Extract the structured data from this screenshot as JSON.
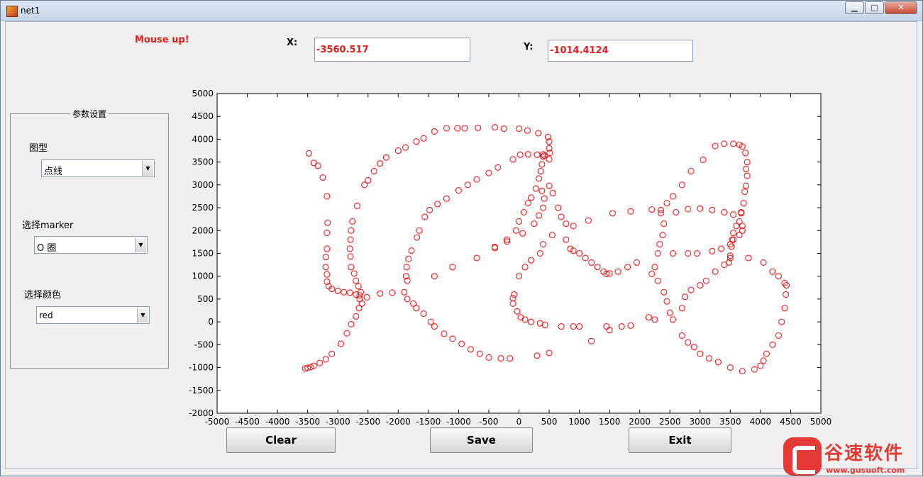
{
  "window": {
    "title": "net1",
    "minimize_glyph": "▁",
    "maximize_glyph": "□",
    "close_glyph": "✕"
  },
  "status": "Mouse up!",
  "coords": {
    "x_label": "X:",
    "x_value": "-3560.517",
    "y_label": "Y:",
    "y_value": "-1014.4124"
  },
  "panel": {
    "title": "参数设置",
    "chart_type": {
      "label": "图型",
      "selected": "点线"
    },
    "marker": {
      "label": "选择marker",
      "selected": "O 圈"
    },
    "color": {
      "label": "选择颜色",
      "selected": "red"
    }
  },
  "buttons": {
    "clear": "Clear",
    "save": "Save",
    "exit": "Exit"
  },
  "watermark": {
    "name": "谷速软件",
    "url": "www.gusuoft.com"
  },
  "colors": {
    "marker": "#ff0000",
    "status_text": "#e41c1c",
    "watermark": "#e53935"
  },
  "icons": {
    "app": "matlab-figure-icon",
    "dropdown": "chevron-down-icon"
  },
  "chart_data": {
    "type": "scatter",
    "marker": "circle",
    "title": "",
    "xlabel": "",
    "ylabel": "",
    "xlim": [
      -5000,
      5000
    ],
    "ylim": [
      -2000,
      5000
    ],
    "xticks": [
      -5000,
      -4500,
      -4000,
      -3500,
      -3000,
      -2500,
      -2000,
      -1500,
      -1000,
      -500,
      0,
      500,
      1000,
      1500,
      2000,
      2500,
      3000,
      3500,
      4000,
      4500,
      5000
    ],
    "yticks": [
      -2000,
      -1500,
      -1000,
      -500,
      0,
      500,
      1000,
      1500,
      2000,
      2500,
      3000,
      3500,
      4000,
      4500,
      5000
    ],
    "grid": false,
    "series": [
      {
        "points": [
          [
            -3540,
            -1020
          ],
          [
            -3500,
            -1010
          ],
          [
            -3450,
            -990
          ],
          [
            -3400,
            -960
          ],
          [
            -3300,
            -900
          ],
          [
            -3200,
            -820
          ],
          [
            -3100,
            -700
          ],
          [
            -2950,
            -480
          ],
          [
            -2850,
            -250
          ],
          [
            -2780,
            -50
          ],
          [
            -2700,
            120
          ],
          [
            -2650,
            300
          ],
          [
            -2640,
            500
          ],
          [
            -2620,
            650
          ],
          [
            -3480,
            3690
          ],
          [
            -3400,
            3480
          ],
          [
            -3330,
            3420
          ],
          [
            -3250,
            3160
          ],
          [
            -3180,
            2750
          ],
          [
            -3170,
            2170
          ],
          [
            -3180,
            1950
          ],
          [
            -3180,
            1600
          ],
          [
            -3200,
            1420
          ],
          [
            -3200,
            1200
          ],
          [
            -3180,
            1040
          ],
          [
            -3180,
            880
          ],
          [
            -3150,
            780
          ],
          [
            -3100,
            720
          ],
          [
            -3000,
            680
          ],
          [
            -2900,
            650
          ],
          [
            -2800,
            640
          ],
          [
            -2700,
            600
          ],
          [
            -2600,
            400
          ],
          [
            -2640,
            580
          ],
          [
            -2660,
            780
          ],
          [
            -2700,
            900
          ],
          [
            -2730,
            1060
          ],
          [
            -2780,
            1200
          ],
          [
            -2790,
            1430
          ],
          [
            -2800,
            1600
          ],
          [
            -2790,
            1800
          ],
          [
            -2780,
            2000
          ],
          [
            -2760,
            2200
          ],
          [
            -2680,
            2540
          ],
          [
            -2560,
            3000
          ],
          [
            -2500,
            3100
          ],
          [
            -2400,
            3300
          ],
          [
            -2300,
            3470
          ],
          [
            -2200,
            3600
          ],
          [
            -2000,
            3750
          ],
          [
            -1880,
            3820
          ],
          [
            -1700,
            3950
          ],
          [
            -1580,
            4020
          ],
          [
            -1400,
            4170
          ],
          [
            -1200,
            4240
          ],
          [
            -1020,
            4240
          ],
          [
            -900,
            4240
          ],
          [
            -680,
            4250
          ],
          [
            -400,
            4260
          ],
          [
            -250,
            4230
          ],
          [
            0,
            4230
          ],
          [
            140,
            4190
          ],
          [
            320,
            4130
          ],
          [
            480,
            4050
          ],
          [
            500,
            3950
          ],
          [
            500,
            3800
          ],
          [
            510,
            3700
          ],
          [
            500,
            3560
          ],
          [
            400,
            3620
          ],
          [
            400,
            3670
          ],
          [
            380,
            3450
          ],
          [
            360,
            3300
          ],
          [
            330,
            3140
          ],
          [
            280,
            2920
          ],
          [
            200,
            2720
          ],
          [
            150,
            2600
          ],
          [
            80,
            2400
          ],
          [
            0,
            2200
          ],
          [
            -50,
            2000
          ],
          [
            -200,
            1800
          ],
          [
            -400,
            1640
          ],
          [
            -700,
            1400
          ],
          [
            -1100,
            1200
          ],
          [
            -1400,
            1000
          ],
          [
            500,
            2980
          ],
          [
            560,
            2820
          ],
          [
            650,
            2500
          ],
          [
            700,
            2300
          ],
          [
            780,
            2150
          ],
          [
            900,
            2100
          ],
          [
            780,
            1800
          ],
          [
            850,
            1600
          ],
          [
            900,
            1560
          ],
          [
            1000,
            1500
          ],
          [
            1100,
            1400
          ],
          [
            1200,
            1300
          ],
          [
            1300,
            1200
          ],
          [
            1400,
            1100
          ],
          [
            1450,
            1050
          ],
          [
            1500,
            1060
          ],
          [
            1640,
            1100
          ],
          [
            1800,
            1200
          ],
          [
            1950,
            1300
          ],
          [
            -1850,
            900
          ],
          [
            -1870,
            1000
          ],
          [
            -1860,
            1200
          ],
          [
            -1830,
            1380
          ],
          [
            -1780,
            1560
          ],
          [
            -1690,
            1850
          ],
          [
            -1650,
            2000
          ],
          [
            -1560,
            2300
          ],
          [
            -1480,
            2450
          ],
          [
            -1350,
            2580
          ],
          [
            -1200,
            2700
          ],
          [
            -1000,
            2880
          ],
          [
            -850,
            3000
          ],
          [
            -700,
            3120
          ],
          [
            -500,
            3260
          ],
          [
            -350,
            3380
          ],
          [
            -100,
            3560
          ],
          [
            20,
            3660
          ],
          [
            150,
            3670
          ],
          [
            300,
            3660
          ],
          [
            420,
            3640
          ],
          [
            -1900,
            650
          ],
          [
            -1850,
            500
          ],
          [
            -1750,
            400
          ],
          [
            -1700,
            300
          ],
          [
            -1580,
            180
          ],
          [
            -1460,
            0
          ],
          [
            -1400,
            -100
          ],
          [
            -1240,
            -260
          ],
          [
            -1100,
            -370
          ],
          [
            -950,
            -480
          ],
          [
            -800,
            -600
          ],
          [
            -650,
            -700
          ],
          [
            -500,
            -780
          ],
          [
            -300,
            -800
          ],
          [
            -150,
            -800
          ],
          [
            -2100,
            640
          ],
          [
            -2300,
            620
          ],
          [
            -2520,
            540
          ],
          [
            -400,
            1620
          ],
          [
            -200,
            1760
          ],
          [
            60,
            1940
          ],
          [
            250,
            2150
          ],
          [
            330,
            2330
          ],
          [
            400,
            2500
          ],
          [
            420,
            2700
          ],
          [
            380,
            2870
          ],
          [
            -100,
            400
          ],
          [
            -80,
            600
          ],
          [
            -100,
            520
          ],
          [
            -30,
            230
          ],
          [
            30,
            100
          ],
          [
            100,
            50
          ],
          [
            200,
            0
          ],
          [
            350,
            -30
          ],
          [
            430,
            -70
          ],
          [
            700,
            -100
          ],
          [
            900,
            -100
          ],
          [
            1000,
            -100
          ],
          [
            1450,
            -100
          ],
          [
            1500,
            -180
          ],
          [
            1700,
            -100
          ],
          [
            1850,
            -80
          ],
          [
            500,
            -680
          ],
          [
            300,
            -740
          ],
          [
            1200,
            -420
          ],
          [
            0,
            1000
          ],
          [
            100,
            1200
          ],
          [
            200,
            1350
          ],
          [
            350,
            1500
          ],
          [
            400,
            1700
          ],
          [
            550,
            1900
          ],
          [
            1150,
            2220
          ],
          [
            1550,
            2380
          ],
          [
            1850,
            2420
          ],
          [
            2200,
            2460
          ],
          [
            2350,
            2380
          ],
          [
            2450,
            2600
          ],
          [
            2550,
            2750
          ],
          [
            2700,
            3000
          ],
          [
            2850,
            3300
          ],
          [
            3050,
            3550
          ],
          [
            3250,
            3850
          ],
          [
            3400,
            3900
          ],
          [
            3550,
            3900
          ],
          [
            3650,
            3880
          ],
          [
            3700,
            3840
          ],
          [
            3750,
            3700
          ],
          [
            3780,
            3500
          ],
          [
            3760,
            3350
          ],
          [
            3780,
            3200
          ],
          [
            3760,
            2980
          ],
          [
            3740,
            2850
          ],
          [
            3720,
            2600
          ],
          [
            3680,
            2380
          ],
          [
            3650,
            2200
          ],
          [
            3600,
            2100
          ],
          [
            3550,
            1950
          ],
          [
            3530,
            1800
          ],
          [
            3520,
            1650
          ],
          [
            3500,
            1450
          ],
          [
            3480,
            1300
          ],
          [
            2350,
            2450
          ],
          [
            2400,
            2150
          ],
          [
            2380,
            1900
          ],
          [
            2330,
            1700
          ],
          [
            2300,
            1500
          ],
          [
            2250,
            1200
          ],
          [
            2200,
            1050
          ],
          [
            2300,
            900
          ],
          [
            2400,
            650
          ],
          [
            2450,
            450
          ],
          [
            2500,
            200
          ],
          [
            2550,
            50
          ],
          [
            2150,
            100
          ],
          [
            2250,
            50
          ],
          [
            2700,
            -300
          ],
          [
            2800,
            -450
          ],
          [
            2900,
            -550
          ],
          [
            3000,
            -700
          ],
          [
            3150,
            -800
          ],
          [
            3300,
            -880
          ],
          [
            3500,
            -1000
          ],
          [
            3700,
            -1080
          ],
          [
            3900,
            -1040
          ],
          [
            4000,
            -960
          ],
          [
            4050,
            -850
          ],
          [
            4100,
            -700
          ],
          [
            4200,
            -500
          ],
          [
            4300,
            -300
          ],
          [
            4350,
            0
          ],
          [
            4400,
            300
          ],
          [
            4420,
            600
          ],
          [
            4430,
            800
          ],
          [
            3800,
            1400
          ],
          [
            4050,
            1300
          ],
          [
            4200,
            1100
          ],
          [
            4300,
            1000
          ],
          [
            4400,
            850
          ],
          [
            2700,
            300
          ],
          [
            2750,
            550
          ],
          [
            2850,
            700
          ],
          [
            3000,
            800
          ],
          [
            3100,
            900
          ],
          [
            3250,
            1100
          ],
          [
            3400,
            1250
          ],
          [
            3500,
            1400
          ],
          [
            2550,
            1500
          ],
          [
            2800,
            1500
          ],
          [
            2950,
            1500
          ],
          [
            3200,
            1550
          ],
          [
            3350,
            1600
          ],
          [
            3500,
            1700
          ],
          [
            3550,
            1800
          ],
          [
            3650,
            1900
          ],
          [
            3700,
            2000
          ],
          [
            3700,
            2100
          ],
          [
            3680,
            2400
          ],
          [
            3550,
            2350
          ],
          [
            3400,
            2400
          ],
          [
            3200,
            2450
          ],
          [
            3000,
            2480
          ],
          [
            2800,
            2470
          ],
          [
            2600,
            2400
          ]
        ]
      }
    ]
  }
}
